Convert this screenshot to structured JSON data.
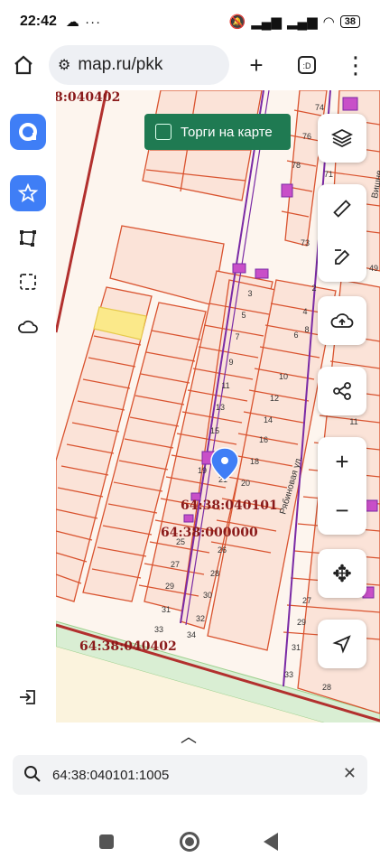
{
  "status": {
    "time": "22:42",
    "battery": "38"
  },
  "browser": {
    "url": "map.ru/pkk"
  },
  "map": {
    "torgi_label": "Торги на карте",
    "labels": [
      "8:040402",
      "64:38:040101",
      "64:38:000000",
      "64:38:040402"
    ],
    "street": "Рябиновая ул.",
    "street2": "Вишне..."
  },
  "search": {
    "value": "64:38:040101:1005"
  },
  "colors": {
    "accent": "#3f7ef6",
    "parcel_line": "#d9532f",
    "parcel_fill": "#fbe3d8",
    "highlight": "#fbe98a",
    "building": "#c84fc8"
  }
}
